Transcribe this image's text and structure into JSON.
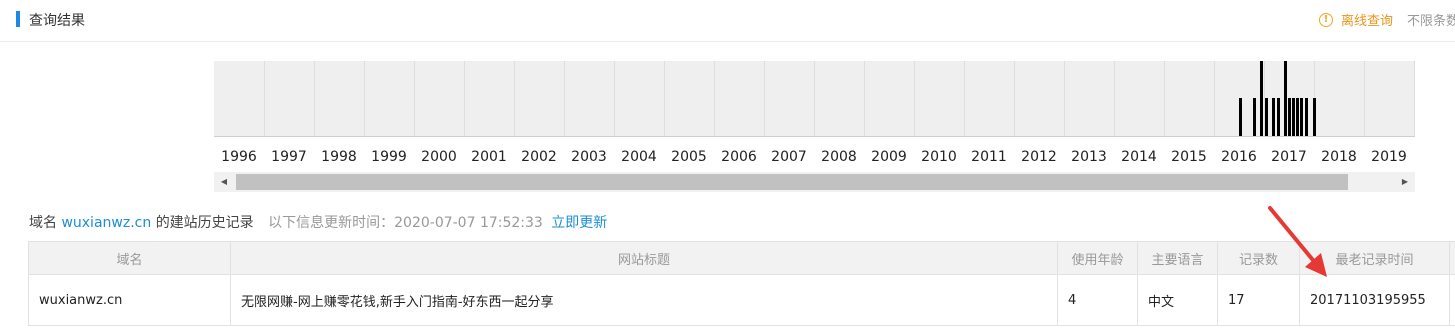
{
  "header": {
    "title": "查询结果",
    "offline_query": "离线查询",
    "unlimited_text": "不限条数"
  },
  "timeline": {
    "years": [
      "1996",
      "1997",
      "1998",
      "1999",
      "2000",
      "2001",
      "2002",
      "2003",
      "2004",
      "2005",
      "2006",
      "2007",
      "2008",
      "2009",
      "2010",
      "2011",
      "2012",
      "2013",
      "2014",
      "2015",
      "2016",
      "2017",
      "2018",
      "2019"
    ],
    "bars": [
      {
        "pos": 0.752,
        "level": 0.5
      },
      {
        "pos": 0.762,
        "level": 0.5
      },
      {
        "pos": 0.767,
        "level": 1.0
      },
      {
        "pos": 0.771,
        "level": 0.5
      },
      {
        "pos": 0.776,
        "level": 0.5
      },
      {
        "pos": 0.78,
        "level": 0.5
      },
      {
        "pos": 0.785,
        "level": 1.0
      },
      {
        "pos": 0.788,
        "level": 0.5
      },
      {
        "pos": 0.791,
        "level": 0.5
      },
      {
        "pos": 0.794,
        "level": 0.5
      },
      {
        "pos": 0.797,
        "level": 0.5
      },
      {
        "pos": 0.8,
        "level": 0.5
      },
      {
        "pos": 0.806,
        "level": 0.5
      }
    ],
    "scroll_left_icon": "arrow-left-icon",
    "scroll_right_icon": "arrow-right-icon"
  },
  "info": {
    "prefix": "域名",
    "domain": "wuxianwz.cn",
    "suffix": "的建站历史记录",
    "update_time": "以下信息更新时间：2020-07-07 17:52:33",
    "update_now": "立即更新"
  },
  "table": {
    "headers": [
      "域名",
      "网站标题",
      "使用年龄",
      "主要语言",
      "记录数",
      "最老记录时间"
    ],
    "rows": [
      {
        "domain": "wuxianwz.cn",
        "title": "无限网赚-网上赚零花钱,新手入门指南-好东西一起分享",
        "age": "4",
        "language": "中文",
        "records": "17",
        "oldest": "20171103195955"
      }
    ]
  },
  "colors": {
    "accent": "#1e88e5",
    "link": "#1a8fd6",
    "warning": "#f5a623",
    "arrow": "#e53935"
  }
}
